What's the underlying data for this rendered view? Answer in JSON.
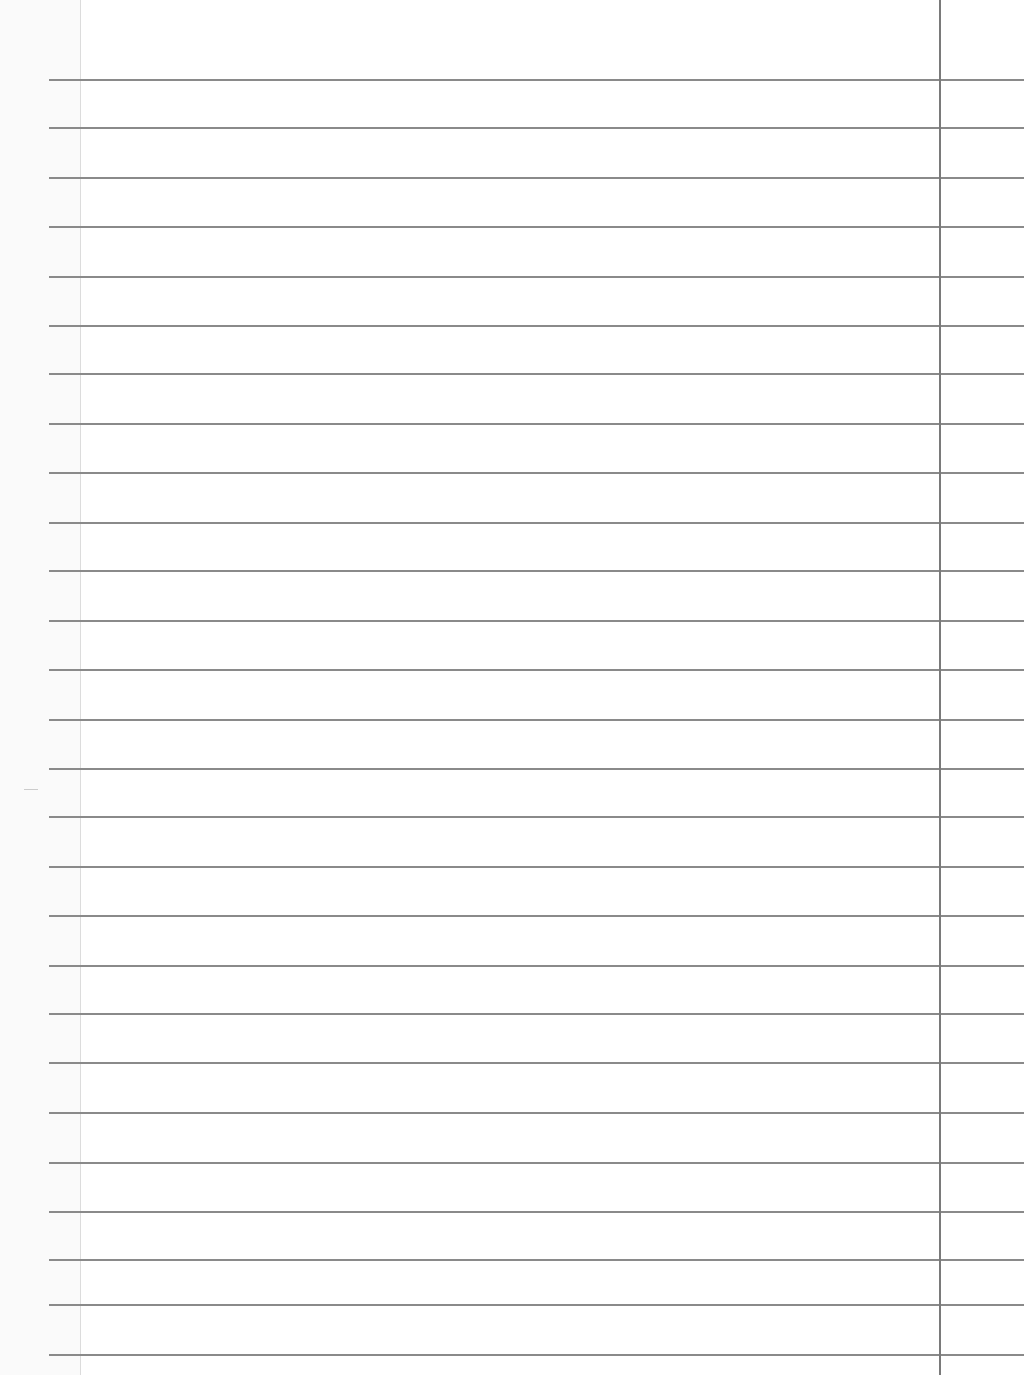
{
  "paper": {
    "background_color": "#ffffff",
    "gutter_color": "#fafafa",
    "ruled_line_color": "#8a8a8a",
    "left_margin_color": "#dcdcdc",
    "right_margin_color": "#7a7a7a"
  }
}
